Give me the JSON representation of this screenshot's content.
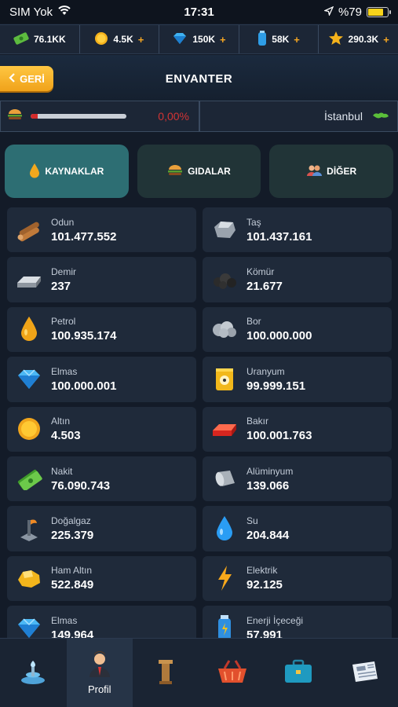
{
  "status": {
    "carrier": "SIM Yok",
    "time": "17:31",
    "battery": "%79",
    "battery_level": 0.79
  },
  "currencies": [
    {
      "icon": "cash-icon",
      "value": "76.1KK",
      "plus": ""
    },
    {
      "icon": "gold-coin-icon",
      "value": "4.5K",
      "plus": "+"
    },
    {
      "icon": "diamond-icon",
      "value": "150K",
      "plus": "+"
    },
    {
      "icon": "energy-drink-icon",
      "value": "58K",
      "plus": "+"
    },
    {
      "icon": "star-icon",
      "value": "290.3K",
      "plus": "+"
    }
  ],
  "header": {
    "back_label": "GERİ",
    "title": "ENVANTER"
  },
  "food": {
    "percent": "0,00%",
    "fill": 0.07
  },
  "city": {
    "name": "İstanbul"
  },
  "tabs": [
    {
      "label": "KAYNAKLAR",
      "icon": "oil-drop-icon",
      "active": true
    },
    {
      "label": "GIDALAR",
      "icon": "burger-icon",
      "active": false
    },
    {
      "label": "DİĞER",
      "icon": "people-icon",
      "active": false
    }
  ],
  "items": [
    {
      "name": "Odun",
      "value": "101.477.552",
      "icon": "wood-icon"
    },
    {
      "name": "Taş",
      "value": "101.437.161",
      "icon": "stone-icon"
    },
    {
      "name": "Demir",
      "value": "237",
      "icon": "iron-icon"
    },
    {
      "name": "Kömür",
      "value": "21.677",
      "icon": "coal-icon"
    },
    {
      "name": "Petrol",
      "value": "100.935.174",
      "icon": "oil-icon"
    },
    {
      "name": "Bor",
      "value": "100.000.000",
      "icon": "boron-icon"
    },
    {
      "name": "Elmas",
      "value": "100.000.001",
      "icon": "diamond-icon"
    },
    {
      "name": "Uranyum",
      "value": "99.999.151",
      "icon": "uranium-icon"
    },
    {
      "name": "Altın",
      "value": "4.503",
      "icon": "gold-coin-icon"
    },
    {
      "name": "Bakır",
      "value": "100.001.763",
      "icon": "copper-icon"
    },
    {
      "name": "Nakit",
      "value": "76.090.743",
      "icon": "cash-icon"
    },
    {
      "name": "Alüminyum",
      "value": "139.066",
      "icon": "aluminium-icon"
    },
    {
      "name": "Doğalgaz",
      "value": "225.379",
      "icon": "gas-icon"
    },
    {
      "name": "Su",
      "value": "204.844",
      "icon": "water-drop-icon"
    },
    {
      "name": "Ham Altın",
      "value": "522.849",
      "icon": "raw-gold-icon"
    },
    {
      "name": "Elektrik",
      "value": "92.125",
      "icon": "lightning-icon"
    },
    {
      "name": "Elmas",
      "value": "149.964",
      "icon": "diamond-icon"
    },
    {
      "name": "Enerji İçeceği",
      "value": "57.991",
      "icon": "energy-drink-icon"
    }
  ],
  "nav": [
    {
      "icon": "fountain-icon",
      "label": "",
      "active": false
    },
    {
      "icon": "businessman-icon",
      "label": "Profil",
      "active": true
    },
    {
      "icon": "pillar-icon",
      "label": "",
      "active": false
    },
    {
      "icon": "basket-icon",
      "label": "",
      "active": false
    },
    {
      "icon": "briefcase-icon",
      "label": "",
      "active": false
    },
    {
      "icon": "newspaper-icon",
      "label": "",
      "active": false
    }
  ]
}
